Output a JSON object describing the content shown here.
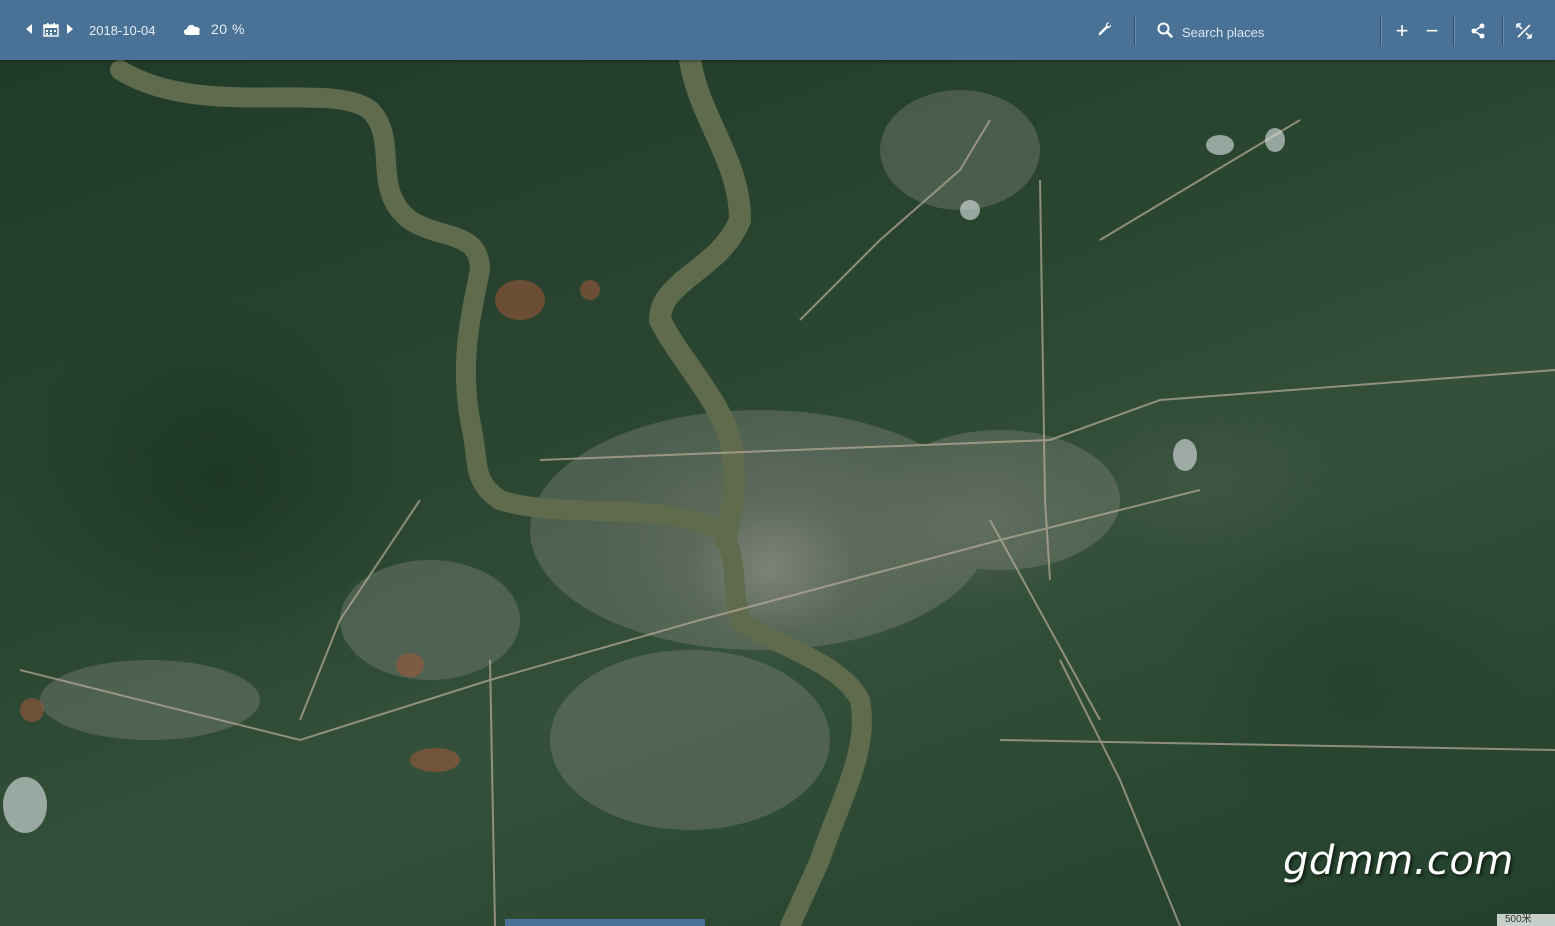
{
  "toolbar": {
    "date": "2018-10-04",
    "cloud_coverage": "20 %",
    "search_placeholder": "Search places",
    "zoom_in": "+",
    "zoom_out": "−",
    "icons": {
      "prev": "prev-date-icon",
      "calendar": "calendar-icon",
      "next": "next-date-icon",
      "cloud": "cloud-icon",
      "tools": "wrench-icon",
      "search": "search-icon",
      "share": "share-icon",
      "fullscreen": "fullscreen-toggle-icon"
    },
    "colors": {
      "bar": "#4a7196",
      "text": "#e7eef5"
    }
  },
  "map": {
    "watermark": "gdmm.com",
    "scale_label": "500米",
    "colors": {
      "river": "#5f6b4c",
      "vegetation": "#2a4631",
      "urban": "#8a8a80"
    }
  }
}
